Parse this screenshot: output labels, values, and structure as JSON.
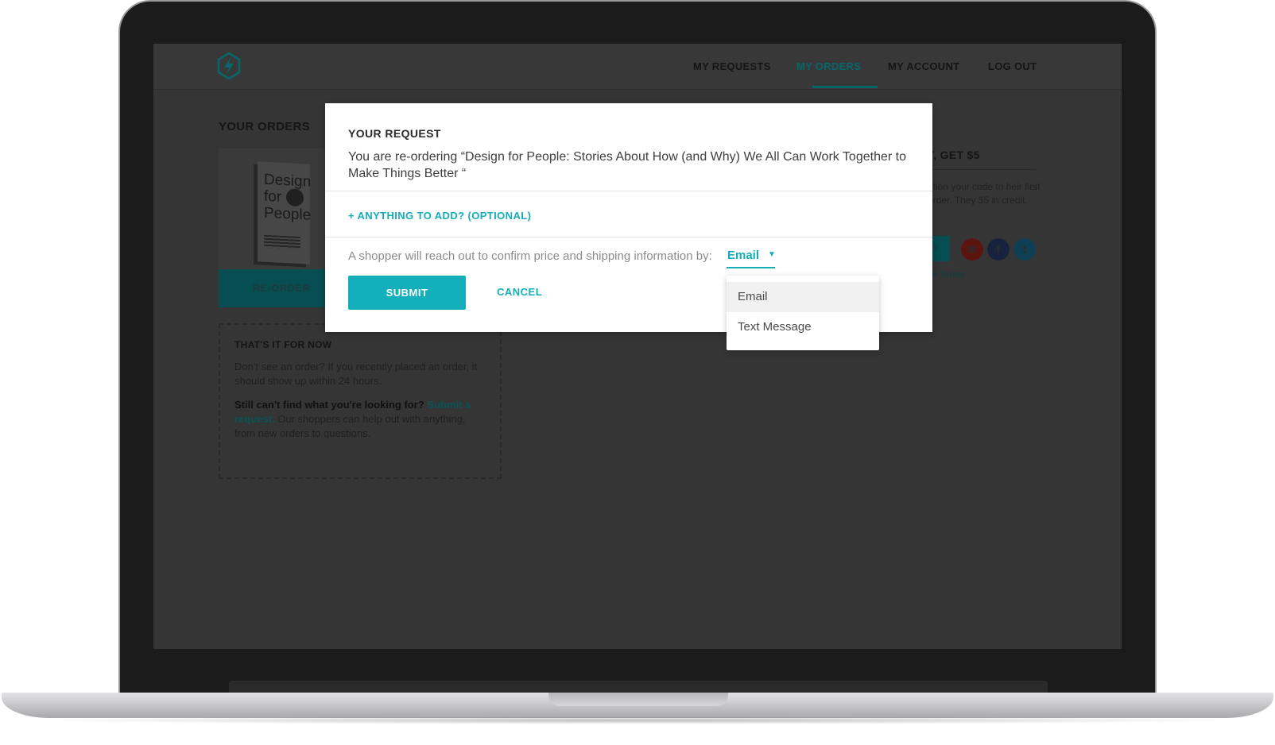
{
  "nav": {
    "items": [
      "MY REQUESTS",
      "MY ORDERS",
      "MY ACCOUNT",
      "LOG OUT"
    ],
    "active": "MY ORDERS"
  },
  "orders": {
    "title": "YOUR ORDERS",
    "book_title_lines": [
      "Design",
      "for",
      "People"
    ],
    "reorder_label": "RE-ORDER"
  },
  "notice": {
    "title": "THAT'S IT FOR NOW",
    "text": "Don't see an order? If you recently placed an order, it should show up within 24 hours.",
    "strong": "Still can't find what you're looking for?",
    "link": "Submit a request.",
    "rest": "Our shoppers can help out with anything, from new orders to questions."
  },
  "referral": {
    "title": "T, GET $5",
    "text": "ntion your code to heir first order. They $5 in credit.",
    "copy_label": "PY",
    "terms": "am Terms"
  },
  "modal": {
    "title": "YOUR REQUEST",
    "description": "You are re-ordering “Design for People: Stories About How (and Why) We All Can Work Together to Make Things Better “",
    "add_link": "+ ANYTHING TO ADD? (OPTIONAL)",
    "confirm_text": "A shopper will reach out to confirm price and shipping information by:",
    "select_value": "Email",
    "options": [
      "Email",
      "Text Message"
    ],
    "submit_label": "SUBMIT",
    "cancel_label": "CANCEL"
  },
  "colors": {
    "accent": "#13afbb",
    "active_nav_dim": "#06666b",
    "overlay_bg": "#353535"
  }
}
